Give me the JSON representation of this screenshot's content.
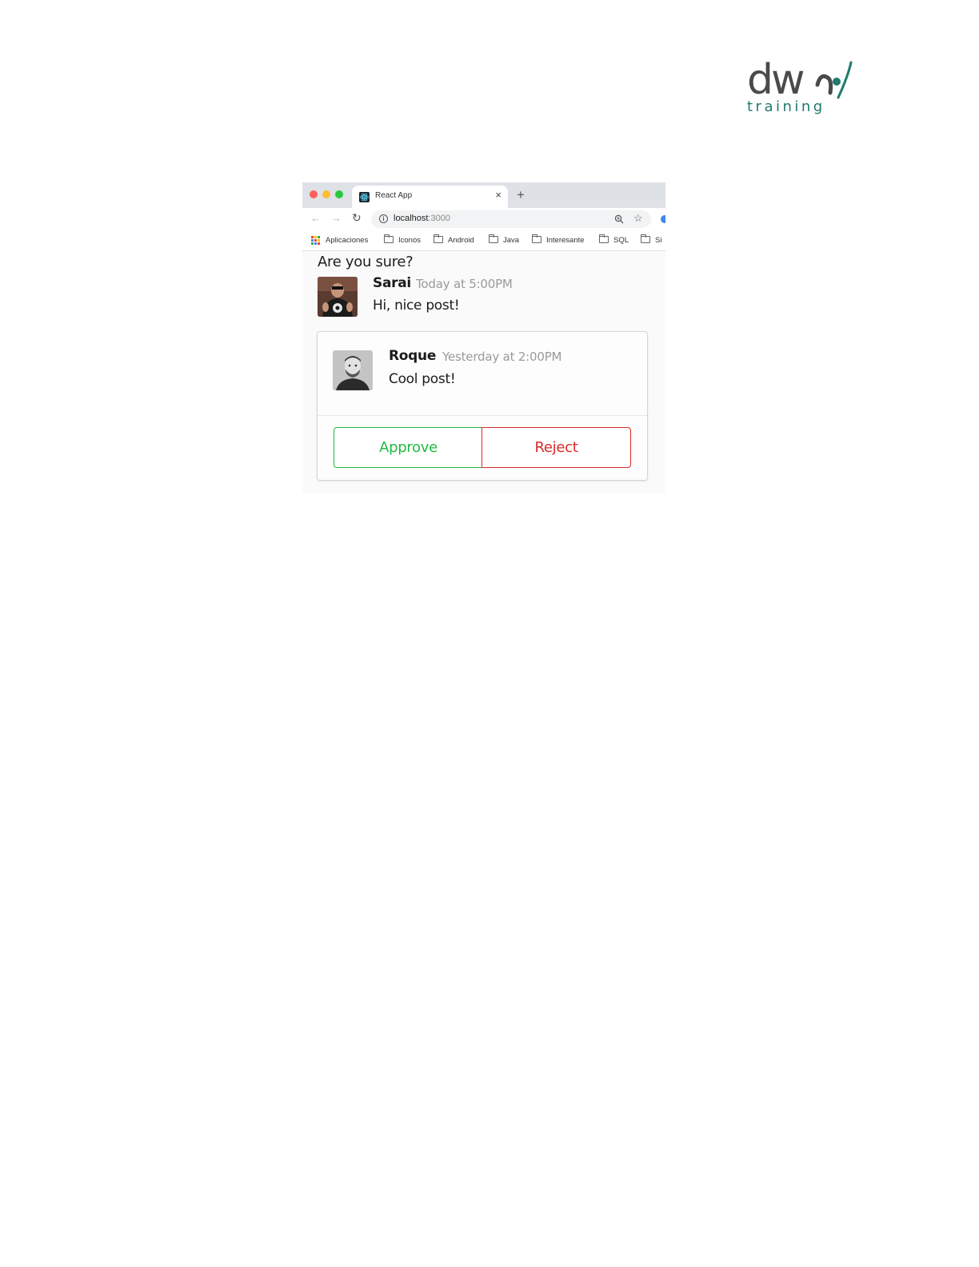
{
  "logo": {
    "wordmark": "dw",
    "tagline": "training"
  },
  "browser": {
    "tab_title": "React App",
    "tab_close": "×",
    "new_tab": "+",
    "url_host": "localhost",
    "url_port": ":3000",
    "bookmarks": [
      "Aplicaciones",
      "Iconos",
      "Android",
      "Java",
      "Interesante",
      "SQL",
      "Si"
    ]
  },
  "page": {
    "question": "Are you sure?",
    "comment": {
      "author": "Sarai",
      "meta": "Today at 5:00PM",
      "text": "Hi, nice post!"
    },
    "card": {
      "author": "Roque",
      "meta": "Yesterday at 2:00PM",
      "text": "Cool post!",
      "approve_label": "Approve",
      "reject_label": "Reject"
    }
  },
  "colors": {
    "approve": "#21ba45",
    "reject": "#db2828",
    "logo_teal": "#1f7a6e"
  },
  "icons": [
    "back-arrow-icon",
    "forward-arrow-icon",
    "reload-icon",
    "info-icon",
    "zoom-icon",
    "star-icon",
    "apps-icon",
    "folder-icon",
    "react-favicon-icon"
  ]
}
